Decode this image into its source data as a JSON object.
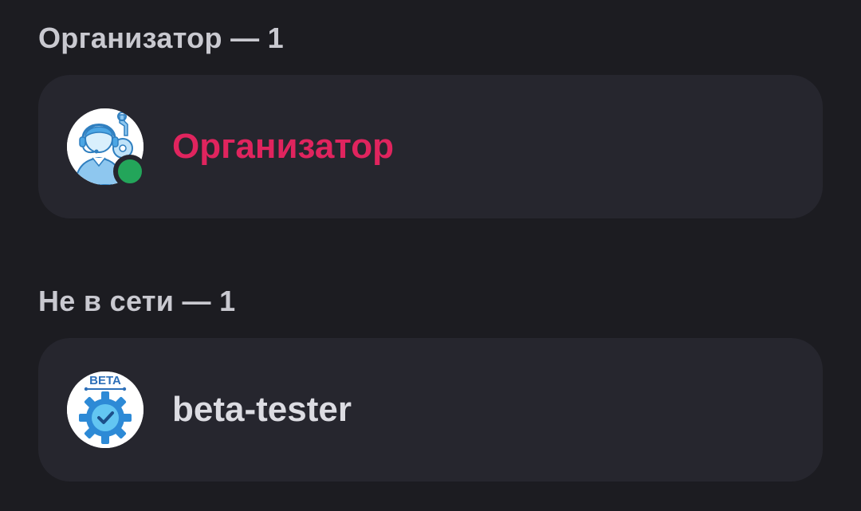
{
  "sections": [
    {
      "header": "Организатор — 1",
      "members": [
        {
          "name": "Организатор",
          "name_color": "#e0245e",
          "avatar_icon": "support-agent-icon",
          "status": "online",
          "status_color": "#23a55a"
        }
      ]
    },
    {
      "header": "Не в сети — 1",
      "members": [
        {
          "name": "beta-tester",
          "name_color": "#dcdce2",
          "avatar_icon": "beta-gear-check-icon",
          "avatar_label": "BETA",
          "status": "offline"
        }
      ]
    }
  ]
}
